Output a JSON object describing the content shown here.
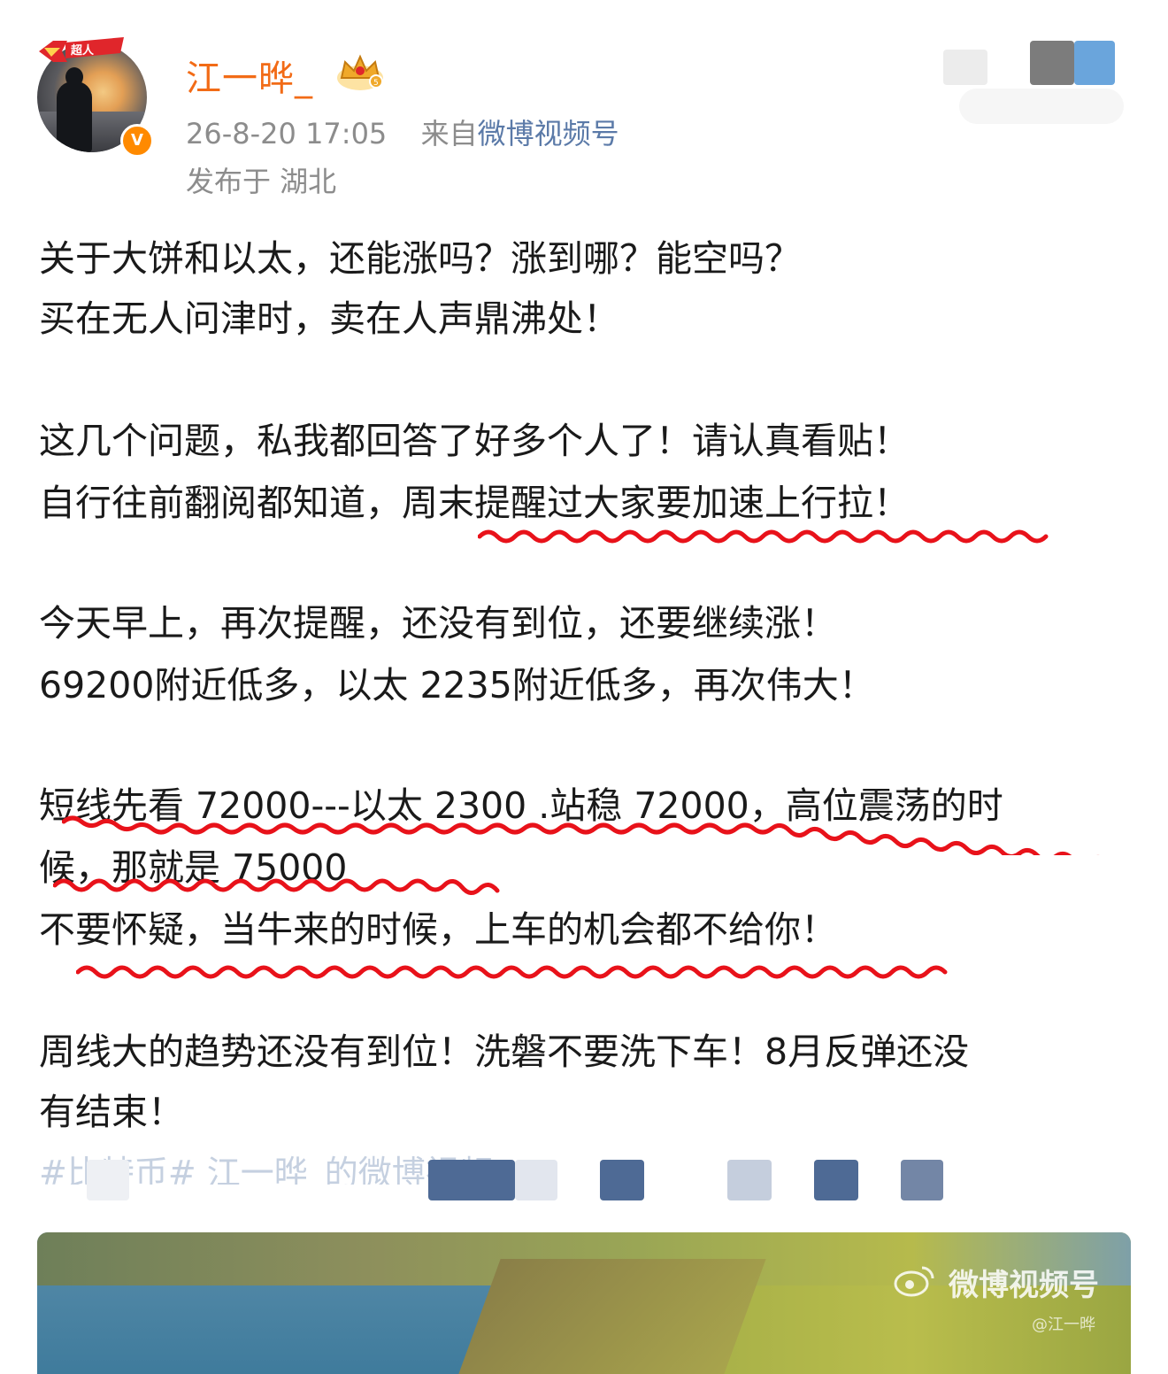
{
  "header": {
    "badge_label": "超人",
    "username": "江一晔_",
    "timestamp": "26-8-20 17:05",
    "source_prefix": "来自",
    "source": "微博视频号",
    "location": "发布于 湖北",
    "verified_mark": "V"
  },
  "post": {
    "lines": [
      "关于大饼和以太，还能涨吗？涨到哪？能空吗？",
      "买在无人问津时，卖在人声鼎沸处！",
      "这几个问题，私我都回答了好多个人了！请认真看贴！",
      "自行往前翻阅都知道，周末提醒过大家要加速上行拉！",
      "今天早上，再次提醒，还没有到位，还要继续涨！",
      "69200附近低多，以太 2235附近低多，再次伟大！",
      "短线先看 72000---以太 2300 .站稳 72000，高位震荡的时",
      "候，那就是 75000",
      "不要怀疑，当牛来的时候，上车的机会都不给你！",
      "周线大的趋势还没有到位！洗磐不要洗下车！8月反弹还没",
      "有结束！"
    ],
    "hashtag": "#比特币# 江一晔_的微博视频"
  },
  "video": {
    "watermark": "微博视频号",
    "watermark_sub": "@江一晔"
  },
  "colors": {
    "username": "#f26b16",
    "link": "#5b7aa8",
    "meta": "#8c8c8c",
    "underline": "#e8121a"
  }
}
